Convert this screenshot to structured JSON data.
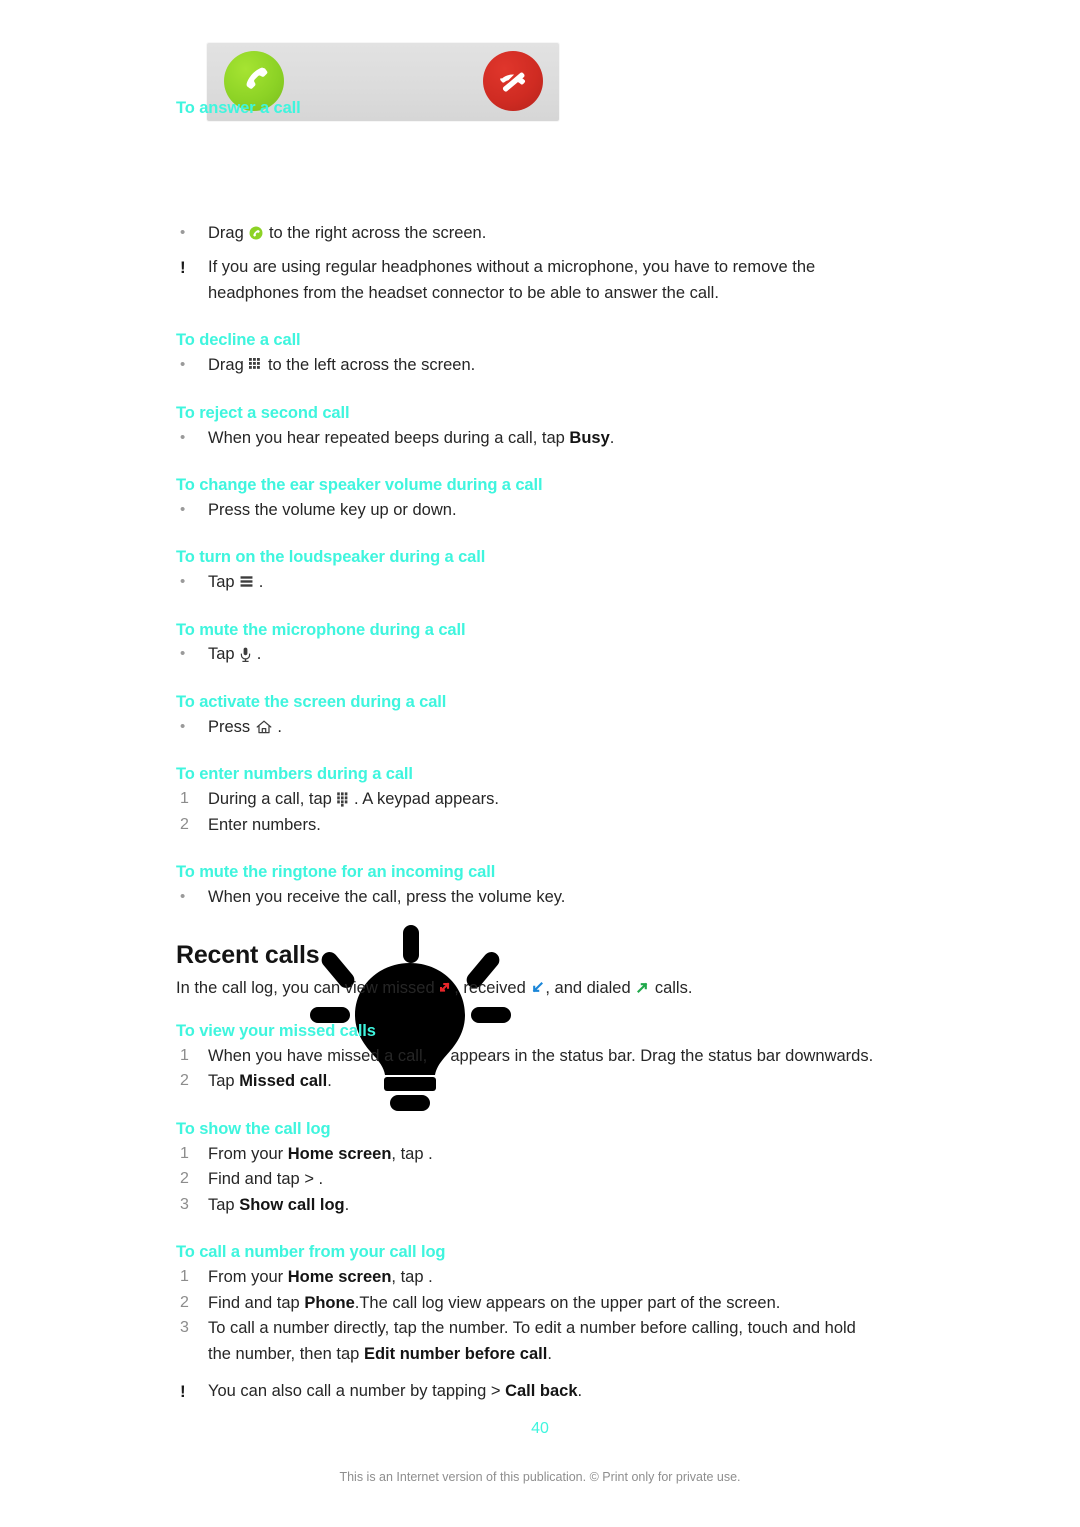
{
  "page": {
    "number": "40",
    "footer_note": "This is an Internet version of this publication. © Print only for private use."
  },
  "sections": {
    "answer_call": {
      "heading": "To answer a call",
      "bullet": {
        "pre": "Drag",
        "post": "to the right across the screen."
      },
      "note": "If you are using regular headphones without a microphone, you have to remove the headphones from the headset connector to be able to answer the call."
    },
    "decline_call": {
      "heading": "To decline a call",
      "bullet": {
        "pre": "Drag",
        "post": "to the left across the screen."
      }
    },
    "reject_second_call": {
      "heading": "To reject a second call",
      "bullet_pre": "When you hear repeated beeps during a call, tap ",
      "bullet_bold": "Busy",
      "bullet_post": "."
    },
    "change_volume": {
      "heading": "To change the ear speaker volume during a call",
      "bullet": "Press the volume key up or down."
    },
    "loudspeaker": {
      "heading": "To turn on the loudspeaker during a call",
      "bullet_pre": "Tap",
      "bullet_post": "."
    },
    "mute_microphone": {
      "heading": "To mute the microphone during a call",
      "bullet_pre": "Tap",
      "bullet_post": "."
    },
    "activate_screen": {
      "heading": "To activate the screen during a call",
      "bullet_pre": "Press",
      "bullet_post": "."
    },
    "enter_numbers": {
      "heading": "To enter numbers during a call",
      "step1_pre": "During a call, tap",
      "step1_post": ". A keypad appears.",
      "step2": "Enter numbers."
    },
    "mute_ringtone": {
      "heading": "To mute the ringtone for an incoming call",
      "bullet": "When you receive the call, press the volume key."
    },
    "recent_calls": {
      "heading": "Recent calls",
      "intro_1": "In the call log, you can view missed ",
      "intro_2": ", received ",
      "intro_3": ", and dialed ",
      "intro_4": " calls."
    },
    "view_missed_calls": {
      "heading": "To view your missed calls",
      "step1_pre": "When you have missed a call, ",
      "step1_post": " appears in the status bar. Drag the status bar downwards.",
      "step2_pre": "Tap ",
      "step2_bold": "Missed call",
      "step2_post": "."
    },
    "show_call_log": {
      "heading": "To show the call log",
      "step1_pre": "From your ",
      "step1_bold": "Home screen",
      "step1_post": ", tap  .",
      "step2": "Find and tap    >  .",
      "step3_pre": "Tap ",
      "step3_bold": "Show call log",
      "step3_post": "."
    },
    "call_number_from_log": {
      "heading": "To call a number from your call log",
      "step1_pre": "From your ",
      "step1_bold": "Home screen",
      "step1_post": ", tap  .",
      "step2_pre": "Find and tap ",
      "step2_bold": "Phone",
      "step2_post": ".The call log view appears on the upper part of the screen.",
      "step3_pre": "To call a number directly, tap the number. To edit a number before calling, touch and hold the number, then tap ",
      "step3_bold": "Edit number before call",
      "step3_post": ".",
      "note_pre": "You can also call a number by tapping   > ",
      "note_bold": "Call back",
      "note_post": "."
    }
  },
  "markers": {
    "bullet": "•",
    "note": "!",
    "one": "1",
    "two": "2",
    "three": "3"
  },
  "colors": {
    "heading_accent": "#3ff5de",
    "answer_button": "#8cd225",
    "decline_button": "#cf2b22",
    "missed_arrow": "#e8262a",
    "received_arrow": "#1b86d8",
    "dialed_arrow": "#1fa84a",
    "body_text": "#262626",
    "marker_gray": "#8c8c8c"
  },
  "icons": {
    "answer_call": "phone-handset-icon",
    "decline_call": "phone-handset-slash-icon",
    "drag_answer": "green-call-circle-icon",
    "drag_decline": "keypad-grid-icon",
    "loudspeaker": "speaker-bars-icon",
    "microphone": "microphone-icon",
    "home": "home-icon",
    "keypad": "keypad-icon",
    "missed": "missed-call-arrow-icon",
    "received": "received-call-arrow-icon",
    "dialed": "dialed-call-arrow-icon",
    "watermark": "lightbulb-icon"
  }
}
